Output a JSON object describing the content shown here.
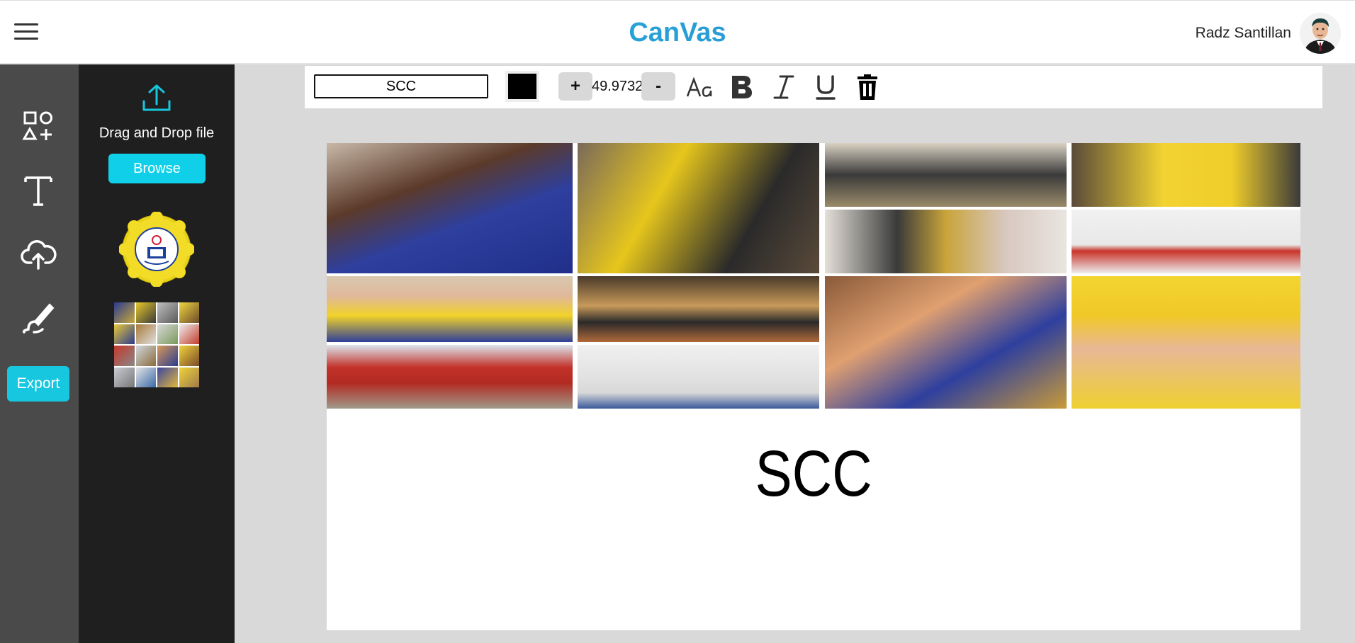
{
  "app": {
    "title": "CanVas"
  },
  "user": {
    "name": "Radz Santillan"
  },
  "sidebar": {
    "tools": [
      {
        "name": "shapes-icon"
      },
      {
        "name": "text-icon"
      },
      {
        "name": "upload-cloud-icon"
      },
      {
        "name": "brush-icon"
      }
    ],
    "export_label": "Export"
  },
  "upload_panel": {
    "drag_label": "Drag and Drop file",
    "browse_label": "Browse",
    "thumbnails": [
      "school-seal-image",
      "photo-collage-image"
    ]
  },
  "text_toolbar": {
    "text_value": "SCC",
    "color": "#000000",
    "increase_label": "+",
    "font_size": "49.9732",
    "decrease_label": "-",
    "icons": [
      "font-icon",
      "bold-icon",
      "italic-icon",
      "underline-icon",
      "trash-icon"
    ]
  },
  "canvas": {
    "text": "SCC",
    "background": "#ffffff"
  },
  "colors": {
    "accent": "#17c6df",
    "brand_start": "#23bfd1",
    "brand_end": "#2e7fd9",
    "rail": "#4a4a4a",
    "panel": "#1f1f1f"
  }
}
